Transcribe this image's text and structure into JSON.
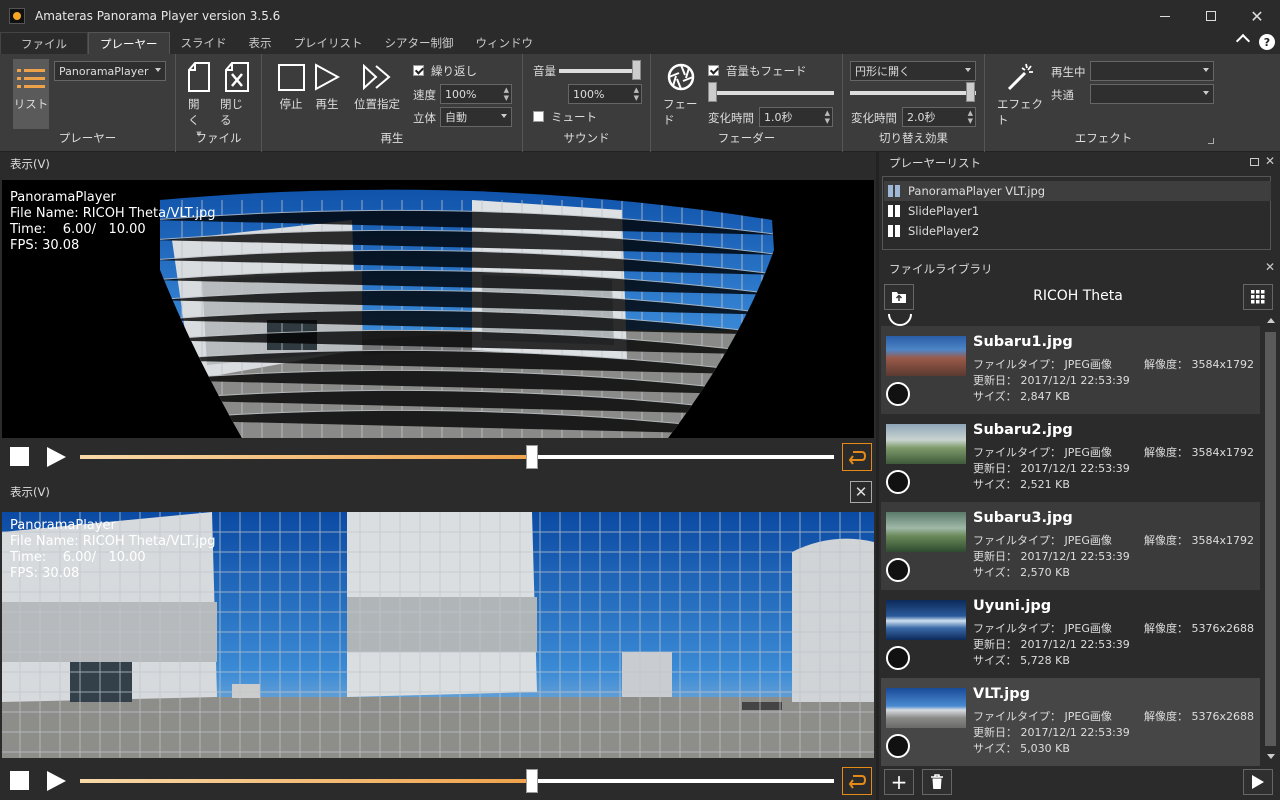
{
  "window": {
    "title": "Amateras Panorama Player version 3.5.6"
  },
  "menu": {
    "tabs": [
      "ファイル",
      "プレーヤー",
      "スライド",
      "表示",
      "プレイリスト",
      "シアター制御",
      "ウィンドウ"
    ],
    "active": "プレーヤー"
  },
  "ribbon": {
    "player": {
      "list_label": "リスト",
      "player_select": "PanoramaPlayer",
      "group": "プレーヤー"
    },
    "file": {
      "open": "開く",
      "close": "閉じる",
      "group": "ファイル"
    },
    "playback": {
      "stop": "停止",
      "play": "再生",
      "seek": "位置指定",
      "repeat": "繰り返し",
      "repeat_checked": true,
      "speed_label": "速度",
      "speed_value": "100%",
      "stereo_label": "立体",
      "stereo_value": "自動",
      "group": "再生"
    },
    "sound": {
      "volume_label": "音量",
      "volume_value": "100%",
      "mute": "ミュート",
      "mute_checked": false,
      "volume_level": 1.0,
      "group": "サウンド"
    },
    "fader": {
      "fade": "フェード",
      "volume_fade": "音量もフェード",
      "volume_fade_checked": true,
      "time_label": "変化時間",
      "time_value": "1.0秒",
      "level": 0.0,
      "group": "フェーダー"
    },
    "transition": {
      "effect_select": "円形に開く",
      "time_label": "変化時間",
      "time_value": "2.0秒",
      "level": 1.0,
      "group": "切り替え効果"
    },
    "effect": {
      "effect": "エフェクト",
      "playing_label": "再生中",
      "common_label": "共通",
      "playing_value": "",
      "common_value": "",
      "group": "エフェクト"
    }
  },
  "view1": {
    "header": "表示(V)",
    "overlay": {
      "line1": "PanoramaPlayer",
      "line2": "File Name: RICOH Theta/VLT.jpg",
      "line3": "Time:    6.00/   10.00",
      "line4": "FPS: 30.08"
    },
    "progress": 0.6
  },
  "view2": {
    "header": "表示(V)",
    "overlay": {
      "line1": "PanoramaPlayer",
      "line2": "File Name: RICOH Theta/VLT.jpg",
      "line3": "Time:    6.00/   10.00",
      "line4": "FPS: 30.08"
    },
    "progress": 0.6
  },
  "playlist": {
    "header": "プレーヤーリスト",
    "items": [
      "PanoramaPlayer  VLT.jpg",
      "SlidePlayer1",
      "SlidePlayer2"
    ]
  },
  "library": {
    "header": "ファイルライブラリ",
    "folder": "RICOH Theta",
    "files": [
      {
        "name": "Subaru1.jpg",
        "type_label": "ファイルタイプ：",
        "type": "JPEG画像",
        "date_label": "更新日：",
        "date": "2017/12/1 22:53:39",
        "size_label": "サイズ：",
        "size": "2,847 KB",
        "res_label": "解像度：",
        "res": "3584x1792"
      },
      {
        "name": "Subaru2.jpg",
        "type_label": "ファイルタイプ：",
        "type": "JPEG画像",
        "date_label": "更新日：",
        "date": "2017/12/1 22:53:39",
        "size_label": "サイズ：",
        "size": "2,521 KB",
        "res_label": "解像度：",
        "res": "3584x1792"
      },
      {
        "name": "Subaru3.jpg",
        "type_label": "ファイルタイプ：",
        "type": "JPEG画像",
        "date_label": "更新日：",
        "date": "2017/12/1 22:53:39",
        "size_label": "サイズ：",
        "size": "2,570 KB",
        "res_label": "解像度：",
        "res": "3584x1792"
      },
      {
        "name": "Uyuni.jpg",
        "type_label": "ファイルタイプ：",
        "type": "JPEG画像",
        "date_label": "更新日：",
        "date": "2017/12/1 22:53:39",
        "size_label": "サイズ：",
        "size": "5,728 KB",
        "res_label": "解像度：",
        "res": "5376x2688"
      },
      {
        "name": "VLT.jpg",
        "type_label": "ファイルタイプ：",
        "type": "JPEG画像",
        "date_label": "更新日：",
        "date": "2017/12/1 22:53:39",
        "size_label": "サイズ：",
        "size": "5,030 KB",
        "res_label": "解像度：",
        "res": "5376x2688"
      }
    ]
  },
  "colors": {
    "accent": "#e58a17",
    "bg": "#2b2b2b",
    "ribbon": "#3c3c3c"
  }
}
